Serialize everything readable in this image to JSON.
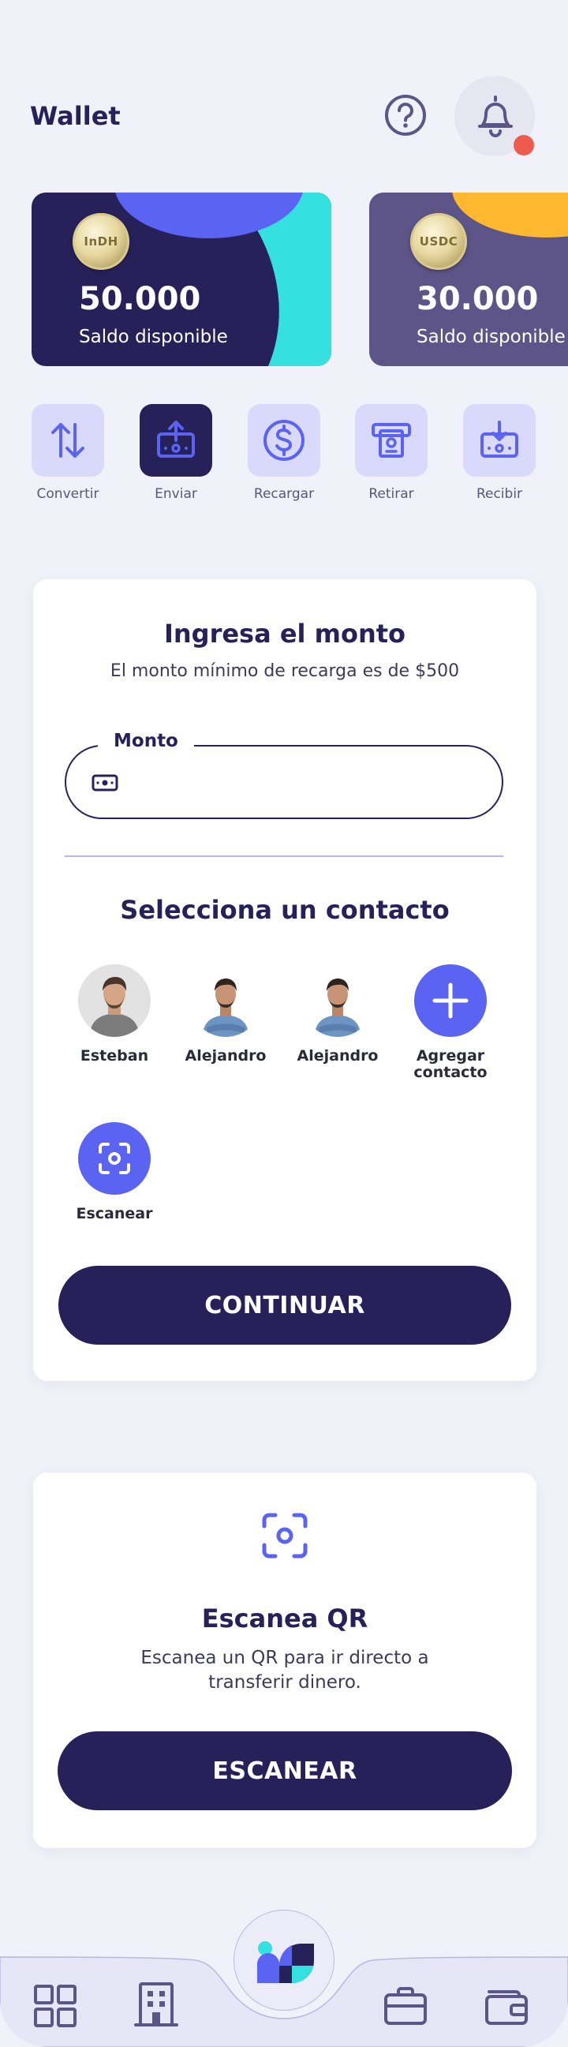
{
  "header": {
    "title": "Wallet"
  },
  "cards": [
    {
      "coin": "InDH",
      "amount": "50.000",
      "label": "Saldo disponible"
    },
    {
      "coin": "USDC",
      "amount": "30.000",
      "label": "Saldo disponible"
    }
  ],
  "actions": [
    {
      "label": "Convertir"
    },
    {
      "label": "Enviar"
    },
    {
      "label": "Recargar"
    },
    {
      "label": "Retirar"
    },
    {
      "label": "Recibir"
    }
  ],
  "amount_panel": {
    "title": "Ingresa el monto",
    "subtitle": "El monto mínimo de recarga es de $500",
    "field_label": "Monto",
    "field_value": "",
    "contacts_title": "Selecciona un contacto",
    "contacts": [
      {
        "name": "Esteban"
      },
      {
        "name": "Alejandro"
      },
      {
        "name": "Alejandro"
      }
    ],
    "add_contact": "Agregar contacto",
    "scan": "Escanear",
    "continue_label": "CONTINUAR"
  },
  "qr_panel": {
    "title": "Escanea QR",
    "subtitle": "Escanea un QR para ir directo a transferir dinero.",
    "button_label": "ESCANEAR"
  },
  "colors": {
    "primary": "#27215a",
    "accent": "#5b63f2",
    "tile": "#d9d9fb",
    "notification": "#ef5a4f",
    "cyan": "#34e0e0",
    "orange": "#ffb830"
  }
}
